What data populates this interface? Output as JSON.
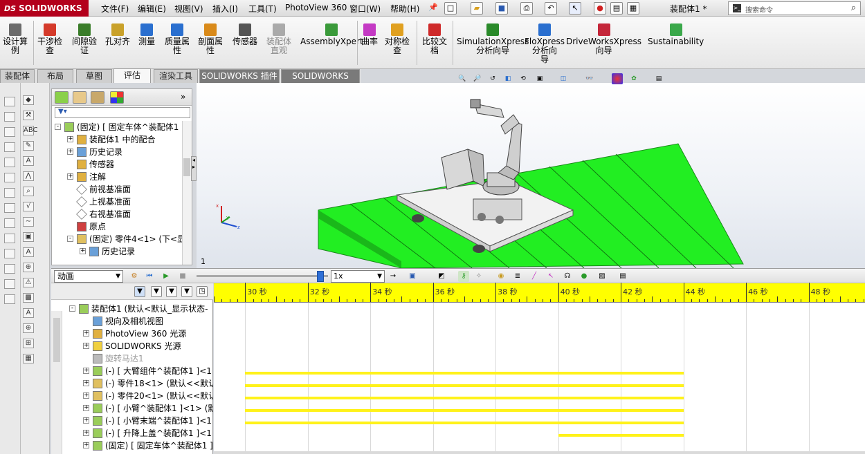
{
  "app": {
    "logo_text": "SOLIDWORKS",
    "logo_ds": "DS"
  },
  "menu": [
    "文件(F)",
    "编辑(E)",
    "视图(V)",
    "插入(I)",
    "工具(T)",
    "PhotoView 360",
    "窗口(W)",
    "帮助(H)"
  ],
  "document_title": "装配体1 *",
  "search": {
    "placeholder": "搜索命令"
  },
  "tools": [
    {
      "label": "设计算\n例",
      "icon": "design-study-icon",
      "color": "#6b6b6b"
    },
    {
      "label": "干涉检\n查",
      "icon": "interference-check-icon",
      "color": "#d43a2a"
    },
    {
      "label": "间隙验\n证",
      "icon": "clearance-verification-icon",
      "color": "#3a7d2a"
    },
    {
      "label": "孔对齐",
      "icon": "hole-alignment-icon",
      "color": "#c9a12a"
    },
    {
      "label": "测量",
      "icon": "measure-icon",
      "color": "#2a6fcf"
    },
    {
      "label": "质量属\n性",
      "icon": "mass-properties-icon",
      "color": "#2a6fcf"
    },
    {
      "label": "剖面属\n性",
      "icon": "section-properties-icon",
      "color": "#d98a1a"
    },
    {
      "label": "传感器",
      "icon": "sensor-icon",
      "color": "#555555"
    },
    {
      "label": "装配体\n直观",
      "icon": "assembly-visualization-icon",
      "color": "#aaaaaa",
      "dim": true
    },
    {
      "label": "AssemblyXpert",
      "icon": "assemblyxpert-icon",
      "color": "#3a9a3a"
    },
    {
      "label": "曲率",
      "icon": "curvature-icon",
      "color": "#c43ac4"
    },
    {
      "label": "对称检\n查",
      "icon": "symmetry-check-icon",
      "color": "#e0a020"
    },
    {
      "label": "比较文\n档",
      "icon": "compare-documents-icon",
      "color": "#cf2a2a"
    },
    {
      "label": "SimulationXpress\n分析向导",
      "icon": "simulationxpress-icon",
      "color": "#2a8a2a"
    },
    {
      "label": "FloXpress\n分析向\n导",
      "icon": "floxpress-icon",
      "color": "#2a6fcf"
    },
    {
      "label": "DriveWorksXpress\n向导",
      "icon": "driveworksxpress-icon",
      "color": "#c4263a"
    },
    {
      "label": "Sustainability",
      "icon": "sustainability-icon",
      "color": "#3aa84a"
    }
  ],
  "tabs": [
    "装配体",
    "布局",
    "草图",
    "评估",
    "渲染工具",
    "SOLIDWORKS 插件",
    "SOLIDWORKS MBD"
  ],
  "active_tab": "评估",
  "feature_tree": [
    {
      "label": "(固定) [ 固定车体^装配体1",
      "icon": "assembly-part-icon",
      "level": 0,
      "expander": "-"
    },
    {
      "label": "装配体1 中的配合",
      "icon": "mates-folder-icon",
      "level": 1,
      "expander": "+"
    },
    {
      "label": "历史记录",
      "icon": "history-icon",
      "level": 1,
      "expander": "+"
    },
    {
      "label": "传感器",
      "icon": "sensor-folder-icon",
      "level": 1,
      "expander": ""
    },
    {
      "label": "注解",
      "icon": "annotations-icon",
      "level": 1,
      "expander": "+"
    },
    {
      "label": "前视基准面",
      "icon": "plane-icon",
      "level": 1,
      "expander": ""
    },
    {
      "label": "上视基准面",
      "icon": "plane-icon",
      "level": 1,
      "expander": ""
    },
    {
      "label": "右视基准面",
      "icon": "plane-icon",
      "level": 1,
      "expander": ""
    },
    {
      "label": "原点",
      "icon": "origin-icon",
      "level": 1,
      "expander": ""
    },
    {
      "label": "(固定) 零件4<1> (下<显",
      "icon": "part-icon",
      "level": 1,
      "expander": "-"
    },
    {
      "label": "历史记录",
      "icon": "history-icon",
      "level": 2,
      "expander": "+"
    }
  ],
  "motion": {
    "study": "动画",
    "speed": "1x",
    "timeline_labels": [
      "30 秒",
      "32 秒",
      "34 秒",
      "36 秒",
      "38 秒",
      "40 秒",
      "42 秒",
      "44 秒",
      "46 秒",
      "48 秒"
    ],
    "time_start": 29,
    "time_end": 49.8,
    "tree": [
      {
        "label": "装配体1 (默认<默认_显示状态-",
        "icon": "assembly-icon",
        "expander": "-",
        "level": 0
      },
      {
        "label": "视向及相机视图",
        "icon": "camera-view-icon",
        "expander": "",
        "level": 1
      },
      {
        "label": "PhotoView 360 光源",
        "icon": "photoview-light-icon",
        "expander": "+",
        "level": 1
      },
      {
        "label": "SOLIDWORKS 光源",
        "icon": "light-icon",
        "expander": "+",
        "level": 1
      },
      {
        "label": "旋转马达1",
        "icon": "rotary-motor-icon",
        "expander": "",
        "level": 1,
        "gray": true
      },
      {
        "label": "(-) [ 大臂组件^装配体1 ]<1",
        "icon": "subassembly-icon",
        "expander": "+",
        "level": 1
      },
      {
        "label": "(-) 零件18<1> (默认<<默认",
        "icon": "part-icon",
        "expander": "+",
        "level": 1
      },
      {
        "label": "(-) 零件20<1> (默认<<默认",
        "icon": "part-icon",
        "expander": "+",
        "level": 1
      },
      {
        "label": "(-) [ 小臂^装配体1 ]<1> (默",
        "icon": "subassembly-icon",
        "expander": "+",
        "level": 1
      },
      {
        "label": "(-) [ 小臂末端^装配体1 ]<1",
        "icon": "subassembly-icon",
        "expander": "+",
        "level": 1
      },
      {
        "label": "(-) [ 升降上盖^装配体1 ]<1",
        "icon": "subassembly-icon",
        "expander": "+",
        "level": 1
      },
      {
        "label": "(固定) [ 固定车体^装配体1 ]",
        "icon": "subassembly-icon",
        "expander": "+",
        "level": 1
      }
    ],
    "keybars": [
      {
        "row": 5,
        "start": 30,
        "end": 44
      },
      {
        "row": 6,
        "start": 30,
        "end": 44
      },
      {
        "row": 7,
        "start": 30,
        "end": 44
      },
      {
        "row": 8,
        "start": 30,
        "end": 44
      },
      {
        "row": 9,
        "start": 30,
        "end": 44
      },
      {
        "row": 10,
        "start": 40,
        "end": 44
      }
    ]
  },
  "page_number": "1",
  "triad_labels": {
    "x": "x",
    "y": "Y",
    "z": "z"
  },
  "colors": {
    "accent": "#b3001b",
    "timeline": "#ffff00",
    "keybar": "#fff21a",
    "floor": "#22ee22"
  }
}
